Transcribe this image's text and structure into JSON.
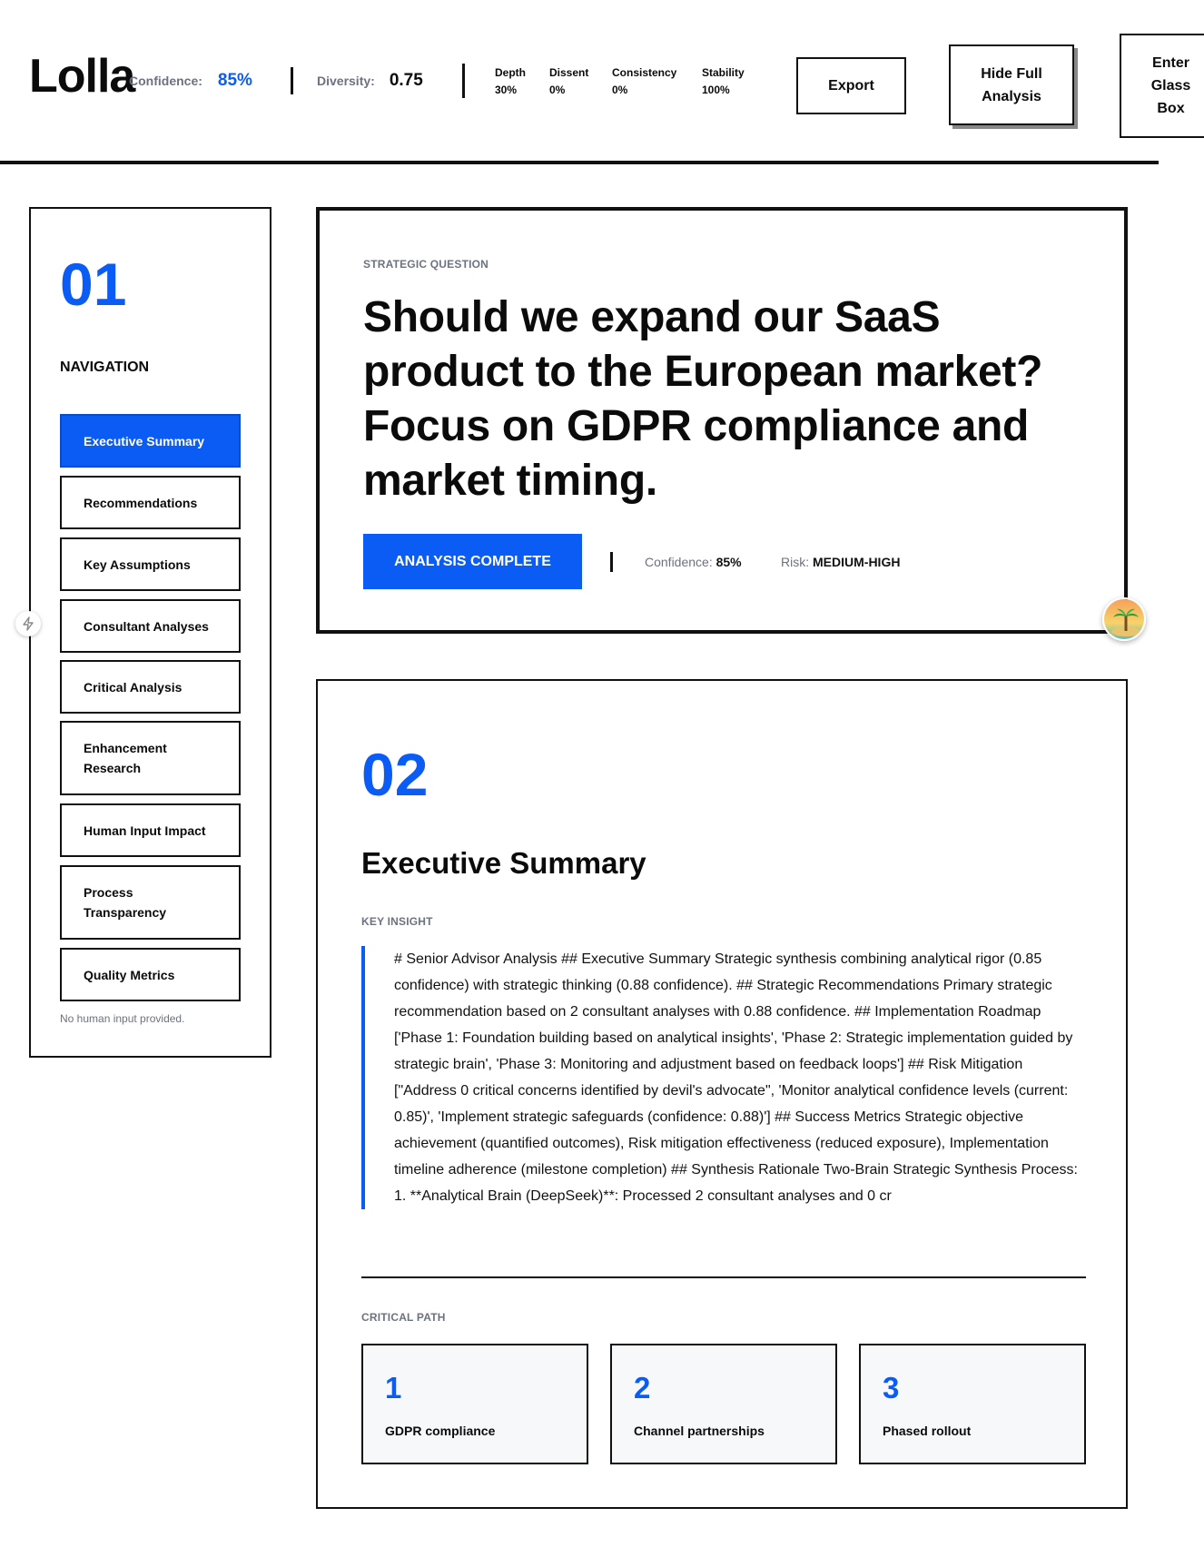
{
  "header": {
    "brand": "Lolla",
    "confidence_label": "Confidence:",
    "confidence_value": "85%",
    "diversity_label": "Diversity:",
    "diversity_value": "0.75",
    "metrics": [
      {
        "label": "Depth",
        "value": "30%"
      },
      {
        "label": "Dissent",
        "value": "0%"
      },
      {
        "label": "Consistency",
        "value": "0%"
      },
      {
        "label": "Stability",
        "value": "100%"
      }
    ],
    "export_label": "Export",
    "hide_label_line1": "Hide Full",
    "hide_label_line2": "Analysis",
    "glass_line1": "Enter",
    "glass_line2": "Glass",
    "glass_line3": "Box"
  },
  "sidebar": {
    "section_number": "01",
    "title": "NAVIGATION",
    "items": [
      {
        "label": "Executive Summary",
        "active": true
      },
      {
        "label": "Recommendations",
        "active": false
      },
      {
        "label": "Key Assumptions",
        "active": false
      },
      {
        "label": "Consultant Analyses",
        "active": false
      },
      {
        "label": "Critical Analysis",
        "active": false
      },
      {
        "label": "Enhancement Research",
        "active": false
      },
      {
        "label": "Human Input Impact",
        "active": false
      },
      {
        "label": "Process Transparency",
        "active": false
      },
      {
        "label": "Quality Metrics",
        "active": false
      }
    ],
    "note": "No human input provided."
  },
  "question": {
    "eyebrow": "STRATEGIC QUESTION",
    "text": "Should we expand our SaaS product to the European market? Focus on GDPR compliance and market timing.",
    "status": "ANALYSIS COMPLETE",
    "confidence_label": "Confidence:",
    "confidence_value": "85%",
    "risk_label": "Risk:",
    "risk_value": "MEDIUM-HIGH"
  },
  "summary": {
    "section_number": "02",
    "title": "Executive Summary",
    "eyebrow": "KEY INSIGHT",
    "insight": "# Senior Advisor Analysis ## Executive Summary Strategic synthesis combining analytical rigor (0.85 confidence) with strategic thinking (0.88 confidence). ## Strategic Recommendations Primary strategic recommendation based on 2 consultant analyses with 0.88 confidence. ## Implementation Roadmap ['Phase 1: Foundation building based on analytical insights', 'Phase 2: Strategic implementation guided by strategic brain', 'Phase 3: Monitoring and adjustment based on feedback loops'] ## Risk Mitigation [\"Address 0 critical concerns identified by devil's advocate\", 'Monitor analytical confidence levels (current: 0.85)', 'Implement strategic safeguards (confidence: 0.88)'] ## Success Metrics Strategic objective achievement (quantified outcomes), Risk mitigation effectiveness (reduced exposure), Implementation timeline adherence (milestone completion) ## Synthesis Rationale Two-Brain Strategic Synthesis Process: 1. **Analytical Brain (DeepSeek)**: Processed 2 consultant analyses and 0 cr",
    "critical_path_label": "CRITICAL PATH",
    "critical_path": [
      {
        "num": "1",
        "label": "GDPR compliance"
      },
      {
        "num": "2",
        "label": "Channel partnerships"
      },
      {
        "num": "3",
        "label": "Phased rollout"
      }
    ]
  },
  "colors": {
    "accent": "#0b5cf5",
    "ink": "#111111",
    "muted": "#6b7280"
  },
  "icons": {
    "floating_left": "lightning-icon",
    "avatar": "island-avatar-icon"
  }
}
